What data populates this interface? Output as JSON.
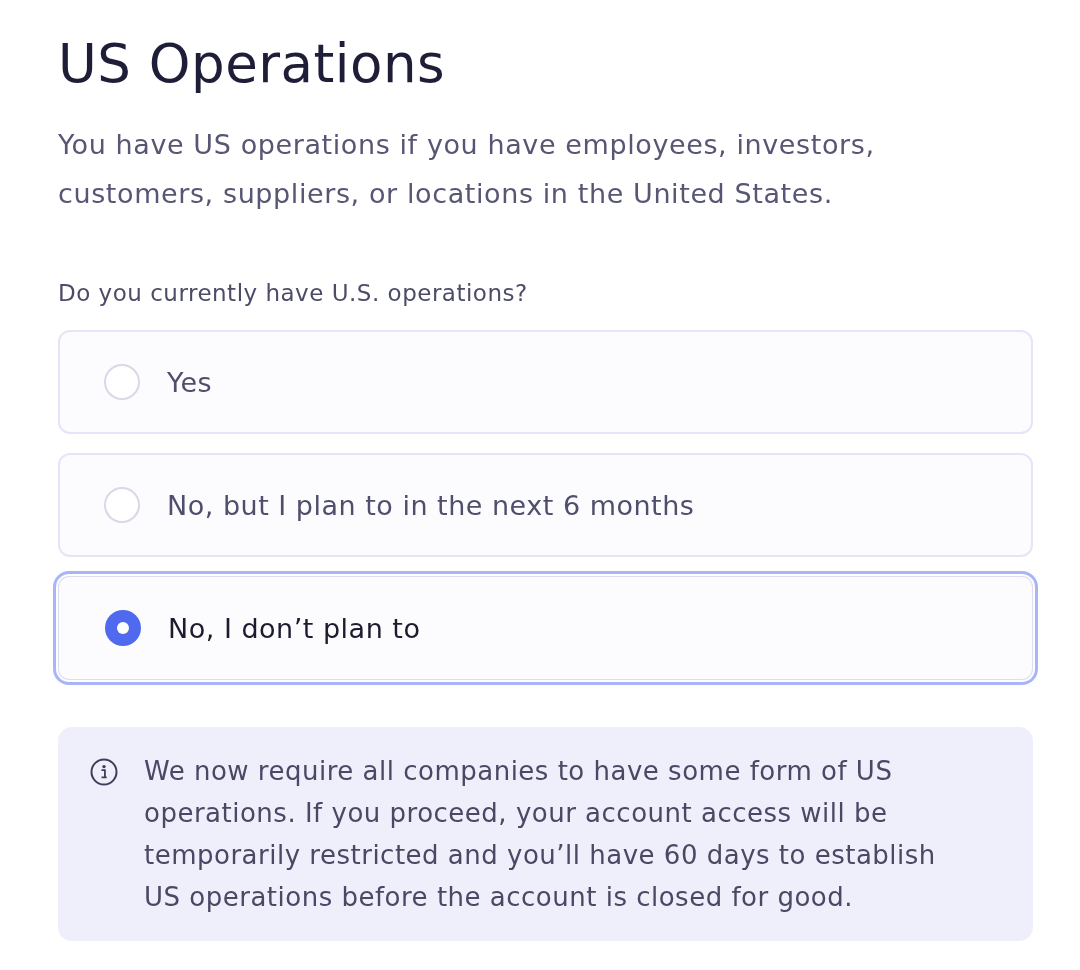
{
  "heading": "US Operations",
  "description": "You have US operations if you have employees, investors, customers, suppliers, or locations in the United States.",
  "question": {
    "label": "Do you currently have U.S. operations?",
    "options": [
      {
        "label": "Yes",
        "selected": false
      },
      {
        "label": "No, but I plan to in the next 6 months",
        "selected": false
      },
      {
        "label": "No, I don’t plan to",
        "selected": true
      }
    ]
  },
  "notice": {
    "text": "We now require all companies to have some form of US operations. If you proceed, your account access will be temporarily restricted and you’ll have 60 days to establish US operations before the account is closed for good."
  }
}
